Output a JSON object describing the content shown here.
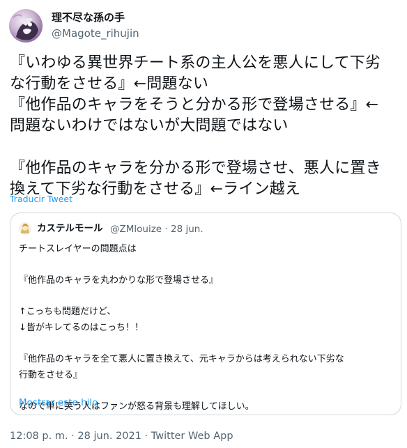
{
  "author": {
    "display_name": "理不尽な孫の手",
    "handle": "@Magote_rihujin"
  },
  "tweet": {
    "lines": [
      "『いわゆる異世界チート系の主人公を悪人にして下劣",
      "な行動をさせる』←問題ない",
      "『他作品のキャラをそうと分かる形で登場させる』←",
      "問題ないわけではないが大問題ではない",
      "",
      "『他作品のキャラを分かる形で登場させ、悪人に置き",
      "換えて下劣な行動をさせる』←ライン越え"
    ],
    "translate_label": "Traducir Tweet"
  },
  "quoted_tweet": {
    "display_name": "カステルモール",
    "handle": "@ZMlouize",
    "separator": "·",
    "date": "28 jun.",
    "lines": [
      "チートスレイヤーの問題点は",
      "",
      "『他作品のキャラを丸わかりな形で登場させる』",
      "",
      "↑こっちも問題だけど、",
      "↓皆がキレてるのはこっち！！",
      "",
      "『他作品のキャラを全て悪人に置き換えて、元キャラからは考えられない下劣な",
      "行動をさせる』",
      "",
      "なので単に笑う人はファンが怒る背景も理解してほしい。"
    ],
    "show_thread_label": "Mostrar este hilo"
  },
  "footer": {
    "text": "12:08 p. m. · 28 jun. 2021 · Twitter Web App"
  },
  "icons": {
    "author_avatar": "avatar-image",
    "quoted_avatar": "avatar-image",
    "more": "more-icon"
  },
  "colors": {
    "link": "#1d9bf0",
    "secondary_text": "#536471",
    "border": "#cfd9de",
    "text": "#0f1419"
  }
}
